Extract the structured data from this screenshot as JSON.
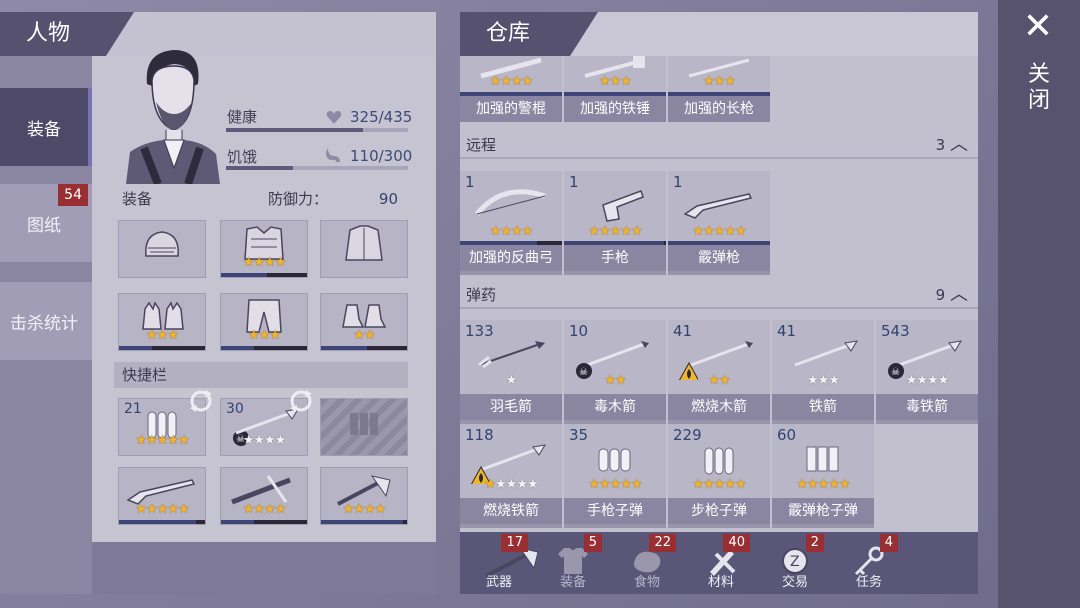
{
  "left": {
    "title": "人物",
    "side_tabs": [
      {
        "label": "装备",
        "active": true
      },
      {
        "label": "图纸",
        "badge": "54"
      },
      {
        "label": "击杀统计"
      }
    ],
    "stats": {
      "health": {
        "label": "健康",
        "value": "325/435",
        "fraction": 0.75
      },
      "hunger": {
        "label": "饥饿",
        "value": "110/300",
        "fraction": 0.37
      }
    },
    "equipment": {
      "label": "装备",
      "defense_label": "防御力：",
      "defense_value": "90"
    },
    "gear": [
      {
        "icon": "beanie-icon",
        "stars": 0
      },
      {
        "icon": "armor-vest-icon",
        "stars": 4,
        "progress": 0.55
      },
      {
        "icon": "jacket-icon",
        "stars": 0
      },
      {
        "icon": "gloves-icon",
        "stars": 3,
        "progress": 0.4
      },
      {
        "icon": "armored-pants-icon",
        "stars": 3,
        "progress": 0.4
      },
      {
        "icon": "boots-icon",
        "stars": 2,
        "progress": 0.55
      }
    ],
    "quickbar_label": "快捷栏",
    "quick": [
      {
        "count": "21",
        "icon": "rifle-ammo-icon",
        "stars": 5
      },
      {
        "count": "30",
        "icon": "poison-iron-arrow-icon",
        "stars": 4,
        "white": 4
      },
      {
        "icon": "empty-ammo-slot-icon",
        "stars": 0
      },
      {
        "icon": "shotgun-icon",
        "stars": 5,
        "progress": 0.9
      },
      {
        "icon": "crossbow-icon",
        "stars": 4,
        "progress": 0.4
      },
      {
        "icon": "axe-icon",
        "stars": 4,
        "progress": 0.95
      }
    ]
  },
  "right": {
    "title": "仓库",
    "top_items": [
      {
        "label": "加强的警棍",
        "stars": 4
      },
      {
        "label": "加强的铁锤",
        "stars": 3
      },
      {
        "label": "加强的长枪",
        "stars": 3
      }
    ],
    "ranged": {
      "label": "远程",
      "count": "3"
    },
    "ranged_items": [
      {
        "count": "1",
        "label": "加强的反曲弓",
        "icon": "recurve-bow-icon",
        "stars": 4,
        "progress": 0.75
      },
      {
        "count": "1",
        "label": "手枪",
        "icon": "revolver-icon",
        "stars": 5,
        "progress": 0.98
      },
      {
        "count": "1",
        "label": "霰弹枪",
        "icon": "shotgun-icon",
        "stars": 5,
        "progress": 1
      }
    ],
    "ammo": {
      "label": "弹药",
      "count": "9"
    },
    "ammo_items": [
      {
        "count": "133",
        "label": "羽毛箭",
        "icon": "feather-arrow-icon",
        "stars": 0,
        "white": 1
      },
      {
        "count": "10",
        "label": "毒木箭",
        "icon": "poison-wood-arrow-icon",
        "stars": 2,
        "white": 0
      },
      {
        "count": "41",
        "label": "燃烧木箭",
        "icon": "fire-wood-arrow-icon",
        "stars": 2,
        "white": 0
      },
      {
        "count": "41",
        "label": "铁箭",
        "icon": "iron-arrow-icon",
        "stars": 0,
        "white": 3
      },
      {
        "count": "543",
        "label": "毒铁箭",
        "icon": "poison-iron-arrow-icon",
        "stars": 0,
        "white": 4
      },
      {
        "count": "118",
        "label": "燃烧铁箭",
        "icon": "fire-iron-arrow-icon",
        "stars": 1,
        "white": 4
      },
      {
        "count": "35",
        "label": "手枪子弹",
        "icon": "pistol-ammo-icon",
        "stars": 5,
        "white": 0
      },
      {
        "count": "229",
        "label": "步枪子弹",
        "icon": "rifle-ammo-icon",
        "stars": 5,
        "white": 0
      },
      {
        "count": "60",
        "label": "霰弹枪子弹",
        "icon": "shotgun-shell-icon",
        "stars": 5,
        "white": 0
      }
    ],
    "bottom_tabs": [
      {
        "label": "武器",
        "badge": "17",
        "icon": "axe-icon"
      },
      {
        "label": "装备",
        "badge": "5",
        "icon": "shirt-icon",
        "dim": true
      },
      {
        "label": "食物",
        "badge": "22",
        "icon": "food-icon",
        "dim": true
      },
      {
        "label": "材料",
        "badge": "40",
        "icon": "materials-icon"
      },
      {
        "label": "交易",
        "badge": "2",
        "icon": "trade-coin-icon"
      },
      {
        "label": "任务",
        "badge": "4",
        "icon": "key-icon"
      }
    ]
  },
  "close": {
    "symbol": "✕",
    "label": "关闭"
  },
  "colors": {
    "star": "#f1b52c",
    "badge": "#9a2f33",
    "progress": "#3d4577",
    "header": "#55516e"
  }
}
